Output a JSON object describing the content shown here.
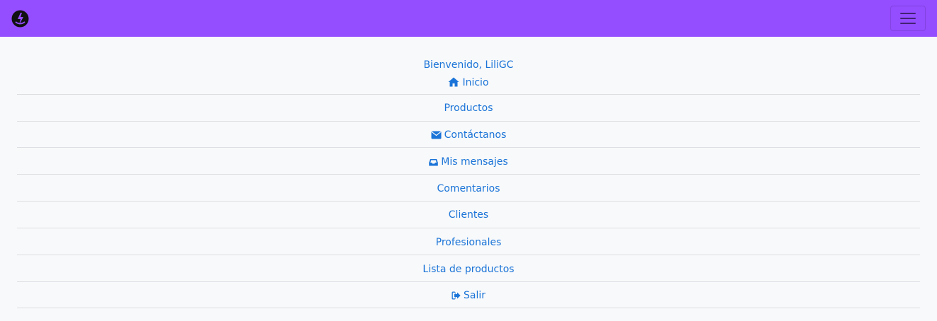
{
  "navbar": {
    "brand_icon": "brand-logo-icon",
    "toggler_icon": "hamburger-icon",
    "background": "#944dff"
  },
  "menu": {
    "welcome": "Bienvenido, LiliGC",
    "items": [
      {
        "label": "Inicio",
        "icon": "home-icon"
      },
      {
        "label": "Productos"
      },
      {
        "label": "Contáctanos",
        "icon": "envelope-icon"
      },
      {
        "label": "Mis mensajes",
        "icon": "inbox-icon"
      },
      {
        "label": "Comentarios"
      },
      {
        "label": "Clientes"
      },
      {
        "label": "Profesionales"
      },
      {
        "label": "Lista de productos"
      },
      {
        "label": "Salir",
        "icon": "sign-out-icon"
      }
    ],
    "link_color": "#1b74d8"
  }
}
